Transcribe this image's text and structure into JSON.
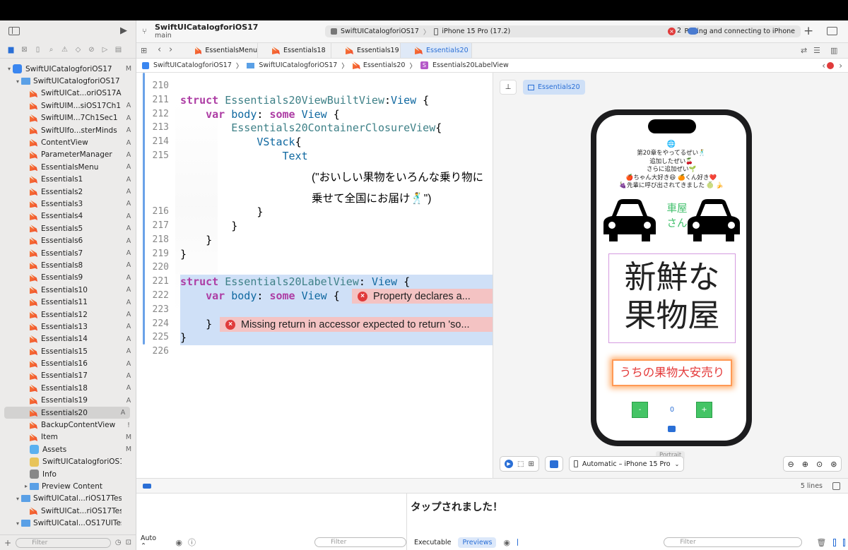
{
  "project": {
    "name": "SwiftUICatalogforiOS17",
    "branch": "main"
  },
  "toolbar": {
    "scheme": "SwiftUICatalogforiOS17",
    "device": "iPhone 15 Pro (17.2)",
    "status": "Pairing and connecting to iPhone",
    "error_count": "2"
  },
  "tabs": [
    "EssentialsMenu",
    "Essentials18",
    "Essentials19",
    "Essentials20"
  ],
  "breadcrumb": [
    "SwiftUICatalogforiOS17",
    "SwiftUICatalogforiOS17",
    "Essentials20",
    "Essentials20LabelView"
  ],
  "navigator": [
    {
      "label": "SwiftUICatalogforiOS17",
      "status": "M",
      "kind": "app",
      "indent": 0,
      "disclosure": "▾"
    },
    {
      "label": "SwiftUICatalogforiOS17",
      "status": "",
      "kind": "folder",
      "indent": 1,
      "disclosure": "▾"
    },
    {
      "label": "SwiftUICat...oriOS17App",
      "status": "",
      "kind": "swift",
      "indent": 2
    },
    {
      "label": "SwiftUIM...siOS17Ch1",
      "status": "A",
      "kind": "swift",
      "indent": 2
    },
    {
      "label": "SwiftUIM...7Ch1Sec1",
      "status": "A",
      "kind": "swift",
      "indent": 2
    },
    {
      "label": "SwiftUIfo...sterMinds",
      "status": "A",
      "kind": "swift",
      "indent": 2
    },
    {
      "label": "ContentView",
      "status": "A",
      "kind": "swift",
      "indent": 2
    },
    {
      "label": "ParameterManager",
      "status": "A",
      "kind": "swift",
      "indent": 2
    },
    {
      "label": "EssentialsMenu",
      "status": "A",
      "kind": "swift",
      "indent": 2
    },
    {
      "label": "Essentials1",
      "status": "A",
      "kind": "swift",
      "indent": 2
    },
    {
      "label": "Essentials2",
      "status": "A",
      "kind": "swift",
      "indent": 2
    },
    {
      "label": "Essentials3",
      "status": "A",
      "kind": "swift",
      "indent": 2
    },
    {
      "label": "Essentials4",
      "status": "A",
      "kind": "swift",
      "indent": 2
    },
    {
      "label": "Essentials5",
      "status": "A",
      "kind": "swift",
      "indent": 2
    },
    {
      "label": "Essentials6",
      "status": "A",
      "kind": "swift",
      "indent": 2
    },
    {
      "label": "Essentials7",
      "status": "A",
      "kind": "swift",
      "indent": 2
    },
    {
      "label": "Essentials8",
      "status": "A",
      "kind": "swift",
      "indent": 2
    },
    {
      "label": "Essentials9",
      "status": "A",
      "kind": "swift",
      "indent": 2
    },
    {
      "label": "Essentials10",
      "status": "A",
      "kind": "swift",
      "indent": 2
    },
    {
      "label": "Essentials11",
      "status": "A",
      "kind": "swift",
      "indent": 2
    },
    {
      "label": "Essentials12",
      "status": "A",
      "kind": "swift",
      "indent": 2
    },
    {
      "label": "Essentials13",
      "status": "A",
      "kind": "swift",
      "indent": 2
    },
    {
      "label": "Essentials14",
      "status": "A",
      "kind": "swift",
      "indent": 2
    },
    {
      "label": "Essentials15",
      "status": "A",
      "kind": "swift",
      "indent": 2
    },
    {
      "label": "Essentials16",
      "status": "A",
      "kind": "swift",
      "indent": 2
    },
    {
      "label": "Essentials17",
      "status": "A",
      "kind": "swift",
      "indent": 2
    },
    {
      "label": "Essentials18",
      "status": "A",
      "kind": "swift",
      "indent": 2
    },
    {
      "label": "Essentials19",
      "status": "A",
      "kind": "swift",
      "indent": 2
    },
    {
      "label": "Essentials20",
      "status": "A",
      "kind": "swift",
      "indent": 2,
      "selected": true
    },
    {
      "label": "BackupContentView",
      "status": "!",
      "kind": "swift",
      "indent": 2
    },
    {
      "label": "Item",
      "status": "M",
      "kind": "swift",
      "indent": 2
    },
    {
      "label": "Assets",
      "status": "M",
      "kind": "assets",
      "indent": 2
    },
    {
      "label": "SwiftUICatalogforiOS17",
      "status": "",
      "kind": "entitlements",
      "indent": 2
    },
    {
      "label": "Info",
      "status": "",
      "kind": "plist",
      "indent": 2
    },
    {
      "label": "Preview Content",
      "status": "",
      "kind": "folder",
      "indent": 2,
      "disclosure": "▸"
    },
    {
      "label": "SwiftUICatal...riOS17Tests",
      "status": "",
      "kind": "folder",
      "indent": 1,
      "disclosure": "▾"
    },
    {
      "label": "SwiftUICat...riOS17Tests",
      "status": "",
      "kind": "swift",
      "indent": 2
    },
    {
      "label": "SwiftUICatal...OS17UITests",
      "status": "",
      "kind": "folder",
      "indent": 1,
      "disclosure": "▾"
    }
  ],
  "code": {
    "line_numbers": [
      "210",
      "211",
      "212",
      "213",
      "214",
      "215",
      "216",
      "217",
      "218",
      "219",
      "220",
      "221",
      "222",
      "223",
      "224",
      "225",
      "226"
    ],
    "lines": [
      {
        "n": "210",
        "html": ""
      },
      {
        "n": "211",
        "html": "<span class='kw'>struct</span> <span class='ty'>Essentials20ViewBuiltView</span>:<span class='ty2'>View</span> {"
      },
      {
        "n": "212",
        "html": "    <span class='kw'>var</span> <span class='ty2'>body</span>: <span class='kw'>some</span> <span class='ty2'>View</span> {"
      },
      {
        "n": "213",
        "html": "        <span class='ty'>Essentials20ContainerClosureView</span>{"
      },
      {
        "n": "214",
        "html": "            <span class='ty2'>VStack</span>{"
      },
      {
        "n": "215",
        "html": "                <span class='ty2'>Text</span>"
      },
      {
        "n": "216",
        "html": "            }"
      },
      {
        "n": "217",
        "html": "        }"
      },
      {
        "n": "218",
        "html": "    }"
      },
      {
        "n": "219",
        "html": "}"
      },
      {
        "n": "220",
        "html": ""
      },
      {
        "n": "221",
        "html": "<span class='kw'>struct</span> <span class='ty'>Essentials20LabelView</span>: <span class='ty2'>View</span> {"
      },
      {
        "n": "222",
        "html": "    <span class='kw'>var</span> <span class='ty2'>body</span>: <span class='kw'>some</span> <span class='ty2'>View</span> {"
      },
      {
        "n": "223",
        "html": ""
      },
      {
        "n": "224",
        "html": "    }"
      },
      {
        "n": "225",
        "html": "}"
      },
      {
        "n": "226",
        "html": ""
      }
    ],
    "string_line1": "(\"おいしい果物をいろんな乗り物に",
    "string_line2": "乗せて全国にお届け🕺\")",
    "error1": "Property declares a...",
    "error2": "Missing return in accessor expected to return 'so..."
  },
  "preview": {
    "tag": "Essentials20",
    "globe": "🌐",
    "lines": [
      "第20章をやってるぜい🕺",
      "追加したぜい🍒",
      "さらに追加ぜい🌱",
      "🍎ちゃん大好き😆 🍊くん好き❤️",
      "🍇先輩に呼び出されてきました 🍈 🍌"
    ],
    "vehicle_label": "車屋さん",
    "headline_1": "新鮮な",
    "headline_2": "果物屋",
    "sale_label": "うちの果物大安売り",
    "minus_label": "-",
    "plus_label": "+",
    "count": "0",
    "orientation": "Portrait",
    "device_select": "Automatic – iPhone 15 Pro"
  },
  "debug": {
    "lines_label": "5 lines"
  },
  "console": {
    "output": "タップされました！",
    "auto": "Auto ⌃",
    "filter_placeholder": "Filter",
    "executable": "Executable",
    "previews": "Previews"
  },
  "navigator_filter": "Filter"
}
